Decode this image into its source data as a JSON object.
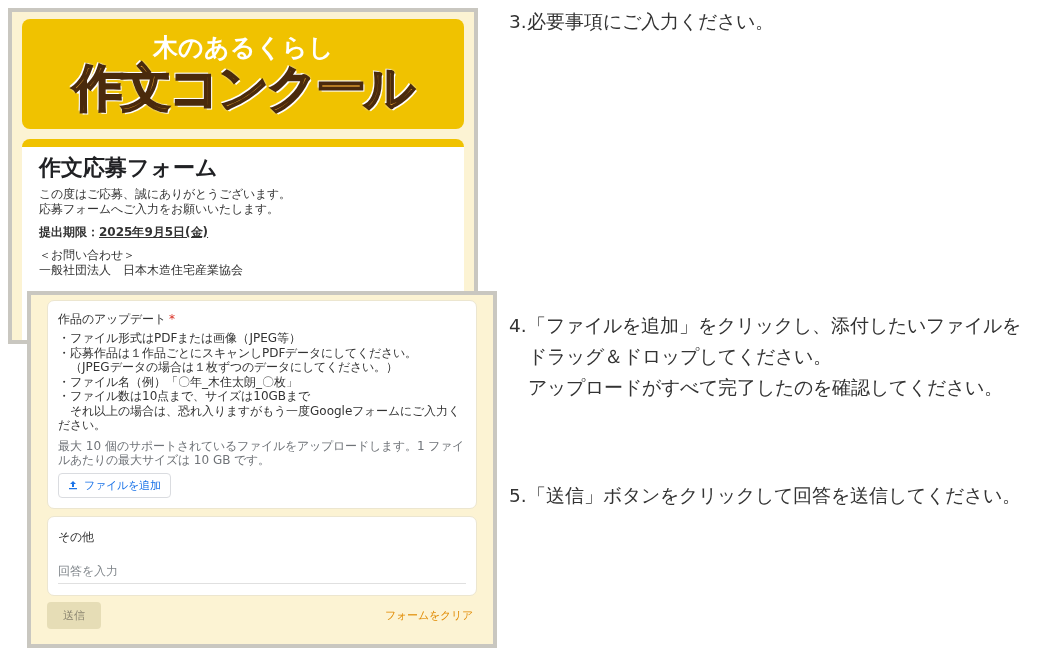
{
  "header_screenshot": {
    "banner": {
      "subtitle": "木のあるくらし",
      "title": "作文コンクール"
    },
    "form_title": "作文応募フォーム",
    "intro": [
      "この度はご応募、誠にありがとうございます。",
      "応募フォームへご入力をお願いいたします。"
    ],
    "deadline": {
      "label": "提出期限：",
      "date": "2025年9月5日(金)"
    },
    "contact": [
      "＜お問い合わせ＞",
      "一般社団法人　日本木造住宅産業協会"
    ]
  },
  "form_screenshot": {
    "upload": {
      "question": "作品のアップデート",
      "required_mark": "*",
      "description": [
        "・ファイル形式はPDFまたは画像（JPEG等）",
        "・応募作品は１作品ごとにスキャンしPDFデータにしてください。",
        "　（JPEGデータの場合は１枚ずつのデータにしてください。）",
        "・ファイル名（例）「〇年_木住太朗_〇枚」",
        "・ファイル数は10点まで、サイズは10GBまで",
        "　それ以上の場合は、恐れ入りますがもう一度Googleフォームにご入力ください。"
      ],
      "hint": "最大 10 個のサポートされているファイルをアップロードします。1 ファイルあたりの最大サイズは 10 GB です。",
      "button": "ファイルを追加"
    },
    "other": {
      "question": "その他",
      "placeholder": "回答を入力"
    },
    "submit": {
      "label": "送信",
      "disabled": true
    },
    "clear": "フォームをクリア"
  },
  "steps": [
    {
      "lines": [
        "3.必要事項にご入力ください。"
      ]
    },
    {
      "lines": [
        "4.「ファイルを追加」をクリックし、添付したいファイルを",
        "ドラッグ＆ドロップしてください。",
        "アップロードがすべて完了したのを確認してください。"
      ]
    },
    {
      "lines": [
        "5.「送信」ボタンをクリックして回答を送信してください。"
      ]
    }
  ]
}
